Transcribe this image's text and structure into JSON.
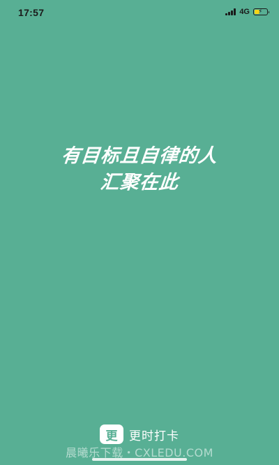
{
  "status_bar": {
    "time": "17:57",
    "network": "4G",
    "battery_level": 0.4
  },
  "slogan": {
    "line1": "有目标且自律的人",
    "line2": "汇聚在此"
  },
  "brand": {
    "logo_char": "更",
    "name": "更时打卡"
  },
  "watermark": "晨曦乐下载・CXLEDU.COM",
  "colors": {
    "background": "#58af94",
    "text": "#ffffff",
    "battery_charge": "#f5d417"
  }
}
